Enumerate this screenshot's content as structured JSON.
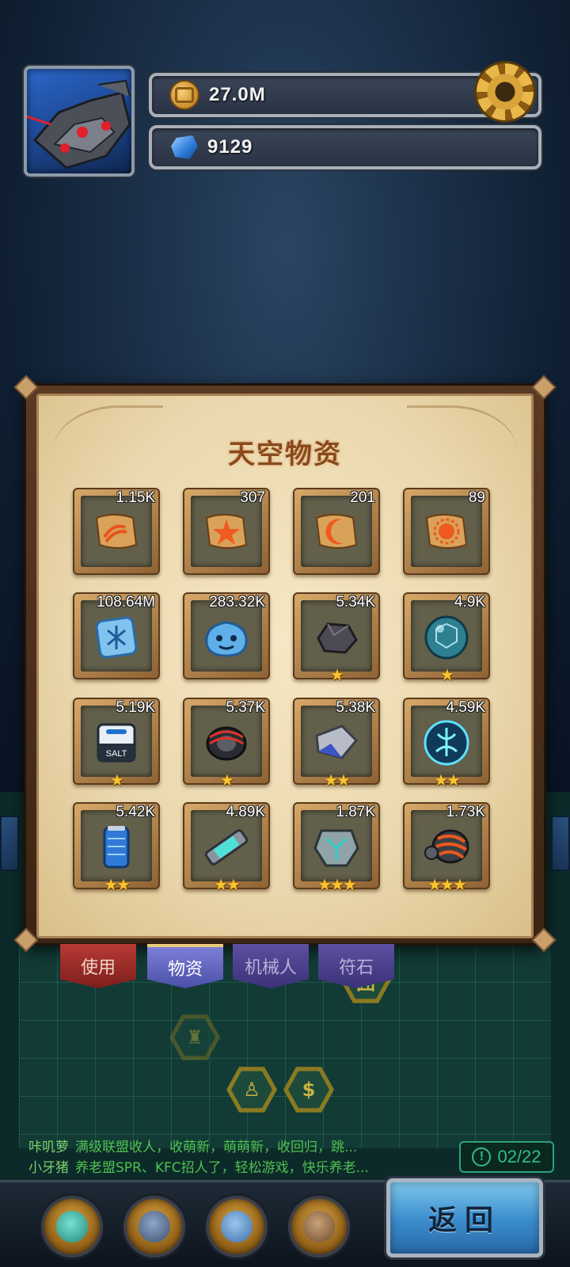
{
  "header": {
    "coins": "27.0M",
    "gems": "9129"
  },
  "panel": {
    "title": "天空物资",
    "items": [
      {
        "count": "1.15K",
        "stars": 0,
        "icon": "scroll-wave-icon"
      },
      {
        "count": "307",
        "stars": 0,
        "icon": "scroll-star-icon"
      },
      {
        "count": "201",
        "stars": 0,
        "icon": "scroll-moon-icon"
      },
      {
        "count": "89",
        "stars": 0,
        "icon": "scroll-sun-icon"
      },
      {
        "count": "108.64M",
        "stars": 0,
        "icon": "crystal-rune-icon"
      },
      {
        "count": "283.32K",
        "stars": 0,
        "icon": "blue-slime-icon"
      },
      {
        "count": "5.34K",
        "stars": 1,
        "icon": "rock-ore-icon"
      },
      {
        "count": "4.9K",
        "stars": 1,
        "icon": "teal-orb-icon"
      },
      {
        "count": "5.19K",
        "stars": 1,
        "icon": "salt-battery-icon"
      },
      {
        "count": "5.37K",
        "stars": 1,
        "icon": "coil-magnet-icon"
      },
      {
        "count": "5.38K",
        "stars": 2,
        "icon": "metal-bracket-icon"
      },
      {
        "count": "4.59K",
        "stars": 2,
        "icon": "energy-sphere-icon"
      },
      {
        "count": "5.42K",
        "stars": 2,
        "icon": "blue-canister-icon"
      },
      {
        "count": "4.89K",
        "stars": 2,
        "icon": "energy-tube-icon"
      },
      {
        "count": "1.87K",
        "stars": 3,
        "icon": "armor-plate-icon"
      },
      {
        "count": "1.73K",
        "stars": 3,
        "icon": "drill-shell-icon"
      }
    ]
  },
  "tabs": [
    "使用",
    "物资",
    "机械人",
    "符石"
  ],
  "chat": [
    {
      "name": "咔叽萝",
      "msg": "满级联盟收人，收萌新，萌萌新，收回归，跳..."
    },
    {
      "name": "小牙猪",
      "msg": "养老盟SPR、KFC招人了，轻松游戏，快乐养老..."
    }
  ],
  "counter": "02/22",
  "back_label": "返回",
  "colors": {
    "panel_parchment": "#ead7ad",
    "title_brown": "#8a4a1e",
    "star_gold": "#f7c531",
    "chat_green": "#4fc24f",
    "back_button_blue": "#3e90cf"
  }
}
